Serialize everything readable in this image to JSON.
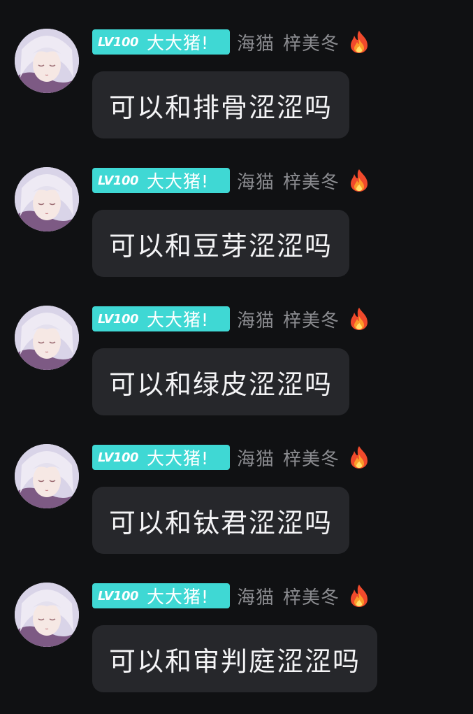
{
  "messages": [
    {
      "level": "LV100",
      "badge_title": "大大猪!",
      "tags": [
        "海猫",
        "梓美冬"
      ],
      "text": "可以和排骨涩涩吗"
    },
    {
      "level": "LV100",
      "badge_title": "大大猪!",
      "tags": [
        "海猫",
        "梓美冬"
      ],
      "text": "可以和豆芽涩涩吗"
    },
    {
      "level": "LV100",
      "badge_title": "大大猪!",
      "tags": [
        "海猫",
        "梓美冬"
      ],
      "text": "可以和绿皮涩涩吗"
    },
    {
      "level": "LV100",
      "badge_title": "大大猪!",
      "tags": [
        "海猫",
        "梓美冬"
      ],
      "text": "可以和钛君涩涩吗"
    },
    {
      "level": "LV100",
      "badge_title": "大大猪!",
      "tags": [
        "海猫",
        "梓美冬"
      ],
      "text": "可以和审判庭涩涩吗"
    }
  ],
  "colors": {
    "background": "#101113",
    "badge": "#3fd8d4",
    "bubble": "#26272b",
    "tag_text": "#8b8c90"
  },
  "icons": {
    "avatar": "anime-girl-avatar",
    "fire": "fire-icon"
  }
}
